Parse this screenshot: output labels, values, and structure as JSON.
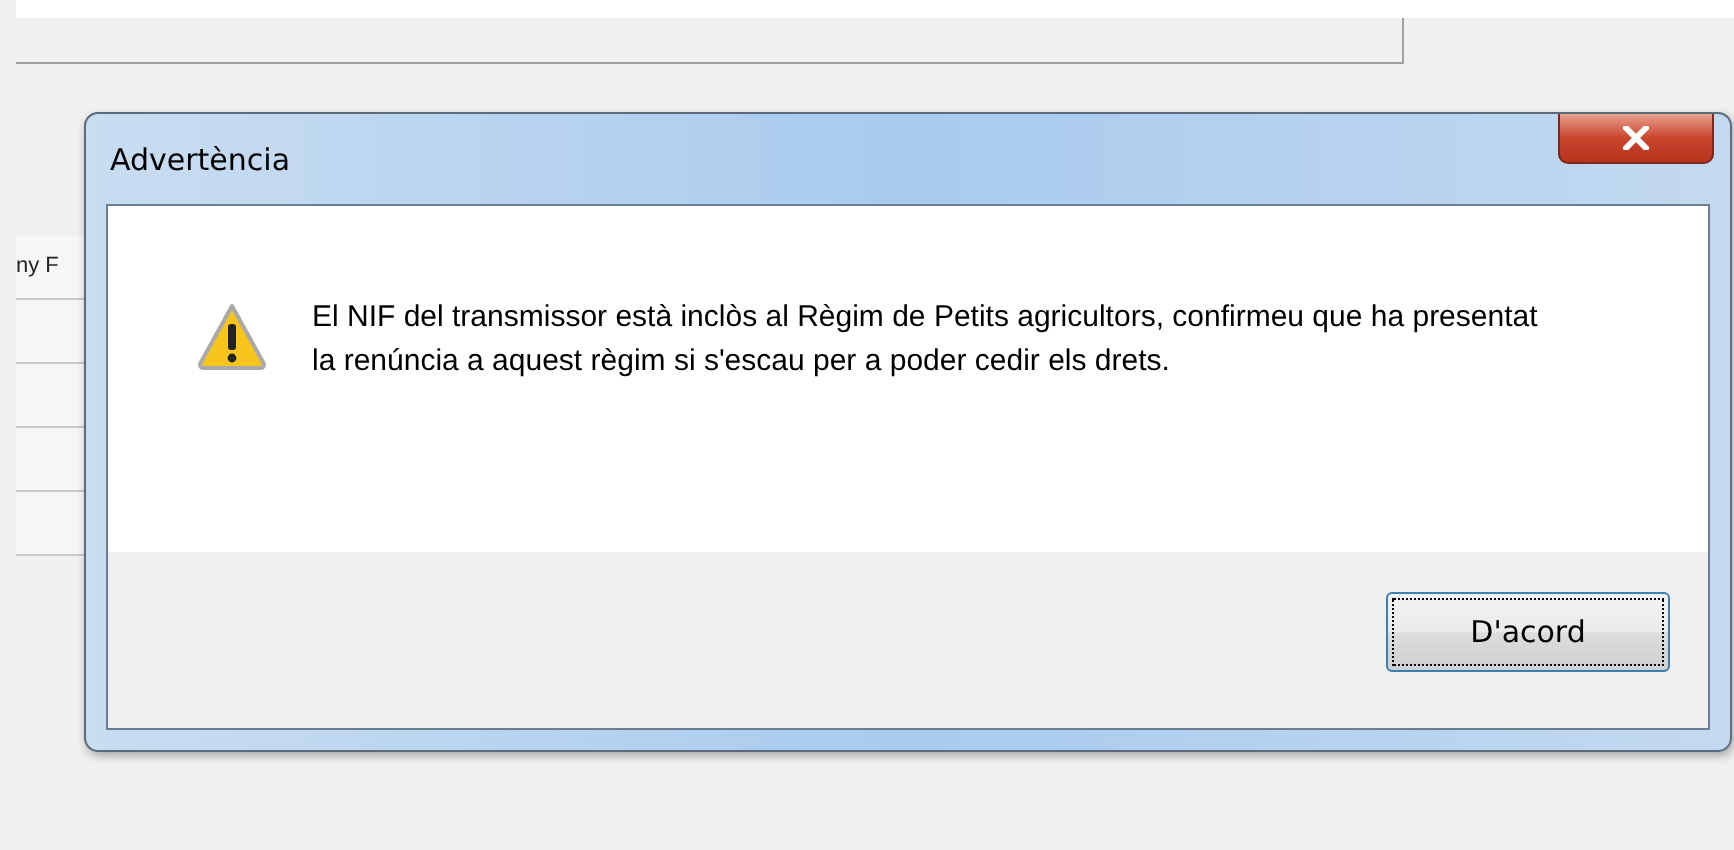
{
  "background": {
    "cut_text": "ny F"
  },
  "dialog": {
    "title": "Advertència",
    "message": "El NIF del transmissor està inclòs al Règim de Petits agricultors, confirmeu que ha presentat la renúncia a aquest règim si s'escau per a poder cedir els drets.",
    "buttons": [
      {
        "label": "D'acord",
        "focused": true
      }
    ]
  }
}
